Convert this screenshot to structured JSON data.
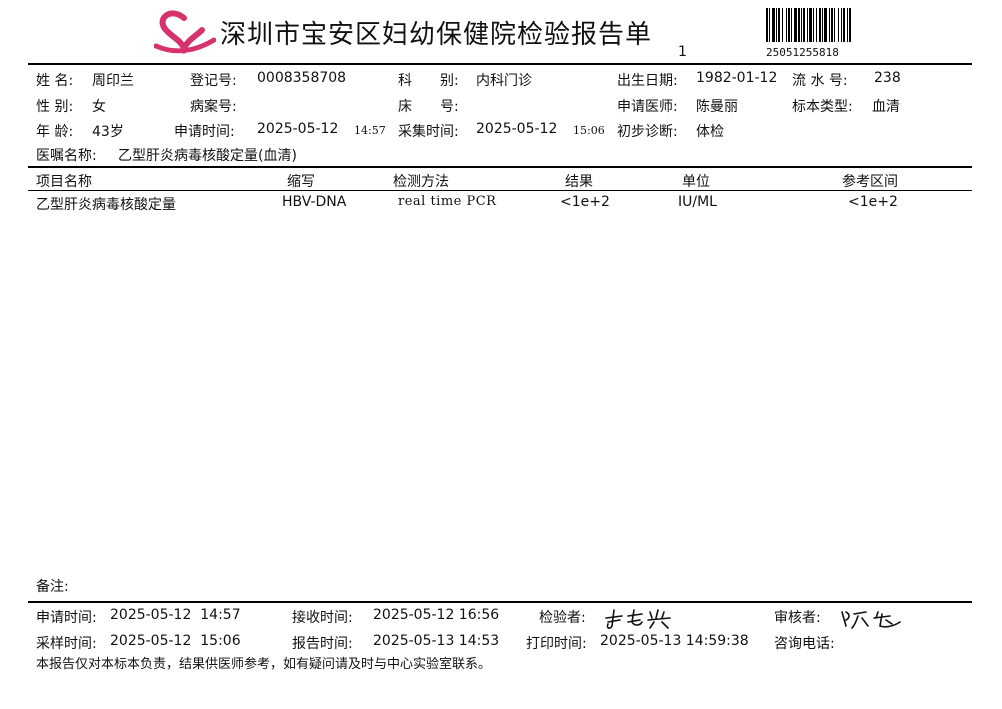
{
  "report": {
    "title": "深圳市宝安区妇幼保健院检验报告单",
    "page_number": "1",
    "barcode_number": "25051255818",
    "logo_color": "#d6336c"
  },
  "patient": {
    "name_label": "姓 名:",
    "name": "周印兰",
    "reg_label": "登记号:",
    "reg_no": "0008358708",
    "dept_label": "科　　别:",
    "dept": "内科门诊",
    "dob_label": "出生日期:",
    "dob": "1982-01-12",
    "serial_label": "流 水 号:",
    "serial": "238",
    "sex_label": "性 别:",
    "sex": "女",
    "case_label": "病案号:",
    "case_no": "",
    "bed_label": "床　　号:",
    "bed": "",
    "doctor_label": "申请医师:",
    "doctor": "陈曼丽",
    "specimen_label": "标本类型:",
    "specimen": "血清",
    "age_label": "年 龄:",
    "age": "43岁",
    "apply_label": "申请时间:",
    "apply_date": "2025-05-12",
    "apply_time": "14:57",
    "collect_label": "采集时间:",
    "collect_date": "2025-05-12",
    "collect_time": "15:06",
    "diag_label": "初步诊断:",
    "diagnosis": "体检",
    "order_label": "医嘱名称:",
    "order": "乙型肝炎病毒核酸定量(血清)"
  },
  "table": {
    "headers": [
      "项目名称",
      "缩写",
      "检测方法",
      "结果",
      "单位",
      "参考区间"
    ],
    "rows": [
      [
        "乙型肝炎病毒核酸定量",
        "HBV-DNA",
        "real time PCR",
        "<1e+2",
        "IU/ML",
        "<1e+2"
      ]
    ]
  },
  "remarks_label": "备注:",
  "footer": {
    "apply_label": "申请时间:",
    "apply_value": "2025-05-12  14:57",
    "receive_label": "接收时间:",
    "receive_value": "2025-05-12 16:56",
    "tester_label": "检验者:",
    "reviewer_label": "审核者:",
    "sample_label": "采样时间:",
    "sample_value": "2025-05-12  15:06",
    "report_label": "报告时间:",
    "report_value": "2025-05-13 14:53",
    "print_label": "打印时间:",
    "print_value": "2025-05-13 14:59:38",
    "phone_label": "咨询电话:",
    "disclaimer": "本报告仅对本标本负责，结果供医师参考，如有疑问请及时与中心实验室联系。"
  }
}
